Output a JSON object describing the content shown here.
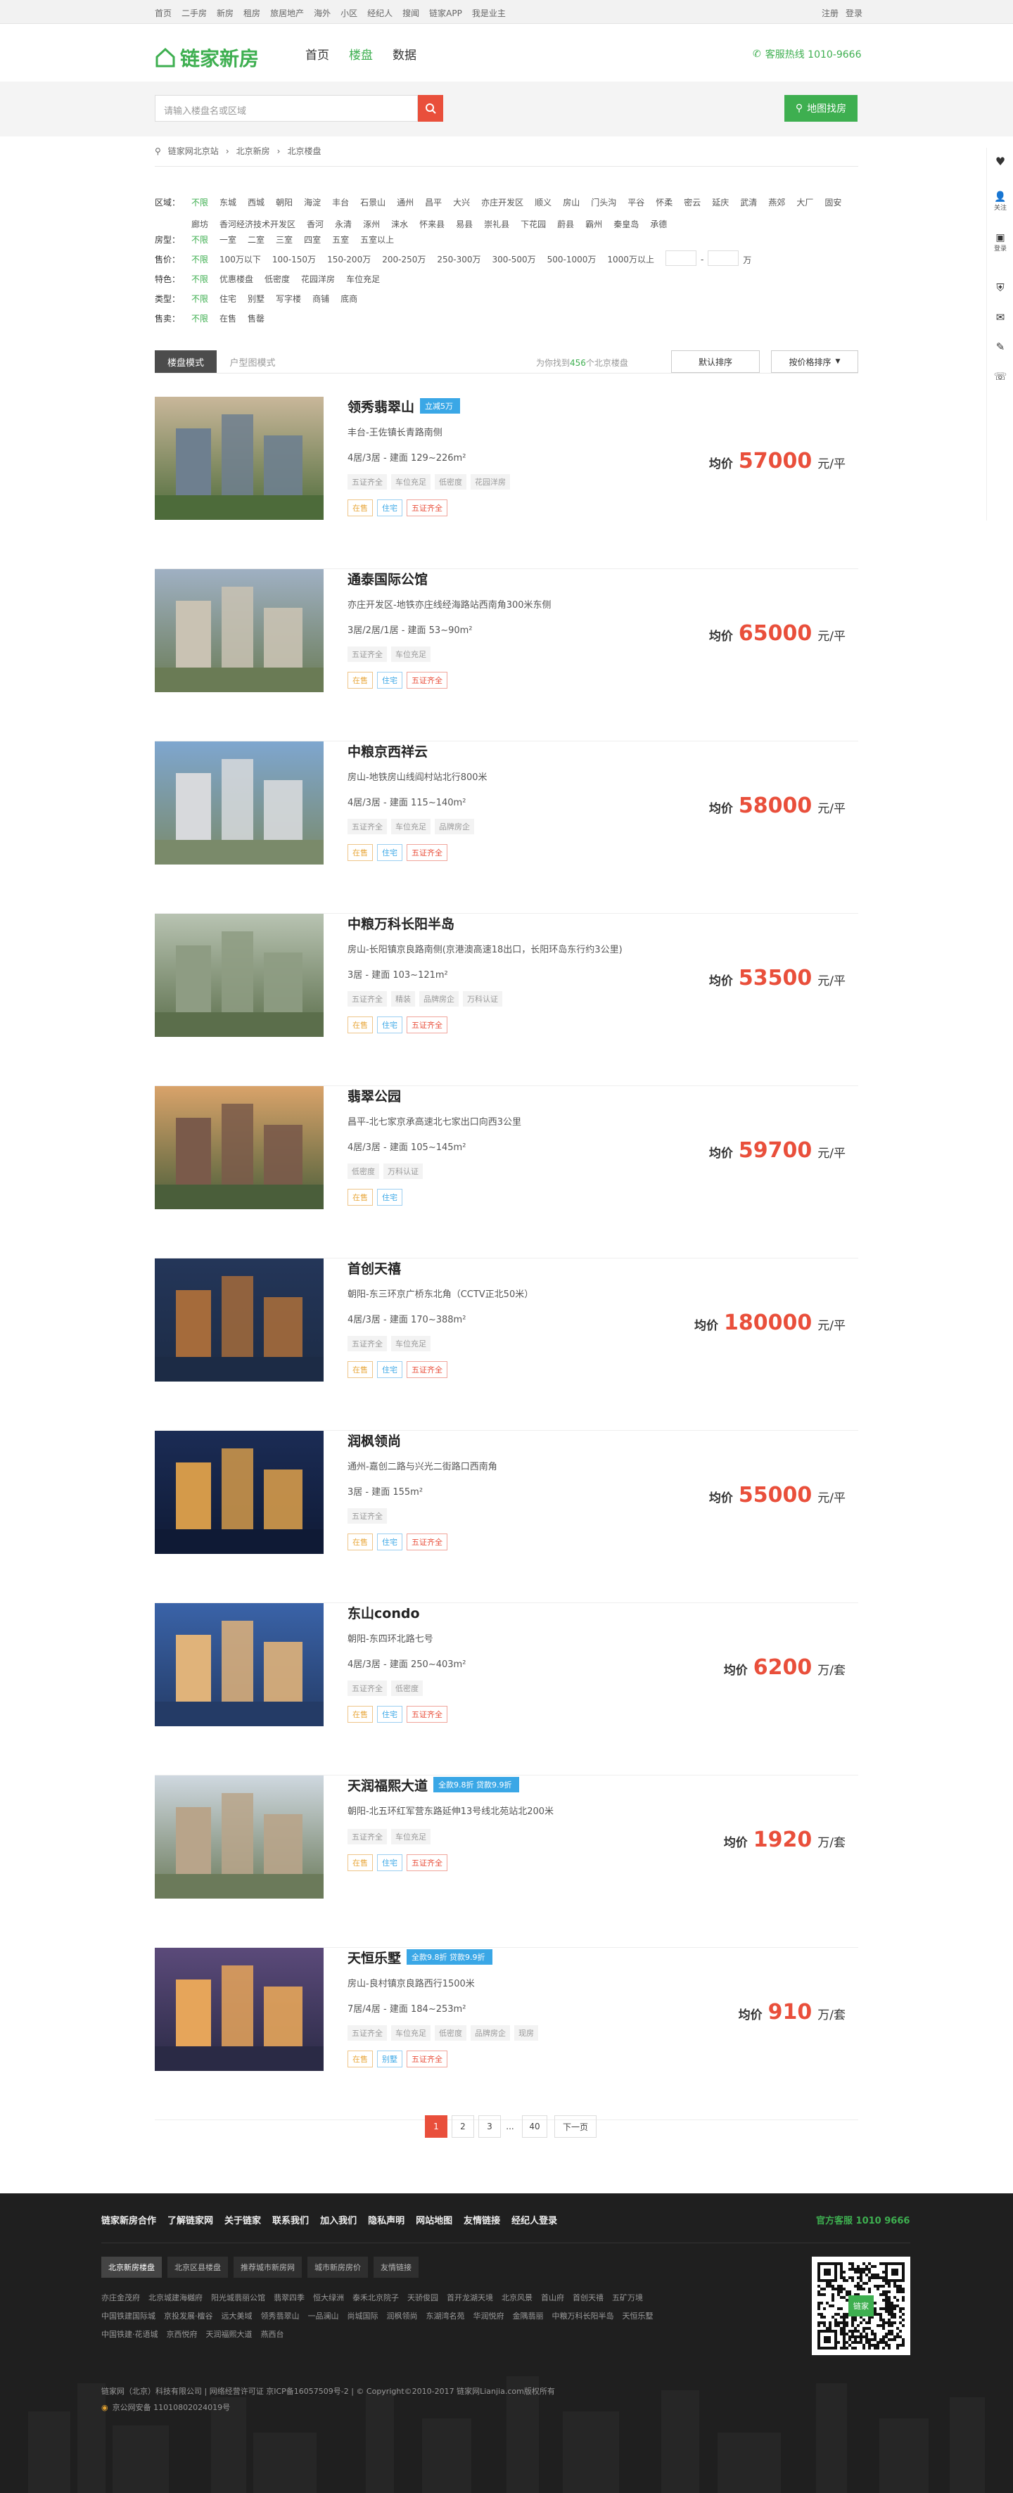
{
  "topbar": {
    "links": [
      "首页",
      "二手房",
      "新房",
      "租房",
      "旅居地产",
      "海外",
      "小区",
      "经纪人",
      "搜闻",
      "链家APP",
      "我是业主"
    ],
    "register": "注册",
    "login": "登录"
  },
  "header": {
    "logo_text": "链家新房",
    "nav": [
      "首页",
      "楼盘",
      "数据"
    ],
    "active_nav": "楼盘",
    "hotline": "客服热线 1010-9666"
  },
  "search": {
    "placeholder": "请输入楼盘名或区域",
    "map_button": "地图找房"
  },
  "right_toolbar": [
    "关注",
    "登录",
    "客服"
  ],
  "breadcrumb": [
    "链家网北京站",
    "北京新房",
    "北京楼盘"
  ],
  "filters": {
    "region": {
      "label": "区域：",
      "options": [
        "不限",
        "东城",
        "西城",
        "朝阳",
        "海淀",
        "丰台",
        "石景山",
        "通州",
        "昌平",
        "大兴",
        "亦庄开发区",
        "顺义",
        "房山",
        "门头沟",
        "平谷",
        "怀柔",
        "密云",
        "延庆",
        "武清",
        "燕郊",
        "大厂",
        "固安",
        "廊坊",
        "香河经济技术开发区",
        "香河",
        "永清",
        "涿州",
        "涞水",
        "怀来县",
        "易县",
        "崇礼县",
        "下花园",
        "蔚县",
        "霸州",
        "秦皇岛",
        "承德"
      ]
    },
    "room": {
      "label": "房型：",
      "options": [
        "不限",
        "一室",
        "二室",
        "三室",
        "四室",
        "五室",
        "五室以上"
      ]
    },
    "price": {
      "label": "售价：",
      "options": [
        "不限",
        "100万以下",
        "100-150万",
        "150-200万",
        "200-250万",
        "250-300万",
        "300-500万",
        "500-1000万",
        "1000万以上"
      ],
      "unit": "万"
    },
    "feature": {
      "label": "特色：",
      "options": [
        "不限",
        "优惠楼盘",
        "低密度",
        "花园洋房",
        "车位充足"
      ]
    },
    "type": {
      "label": "类型：",
      "options": [
        "不限",
        "住宅",
        "别墅",
        "写字楼",
        "商铺",
        "底商"
      ]
    },
    "status": {
      "label": "售卖：",
      "options": [
        "不限",
        "在售",
        "售罄"
      ]
    }
  },
  "list_header": {
    "tab_active": "楼盘模式",
    "tab_inactive": "户型图模式",
    "count_prefix": "为你找到",
    "count": "456",
    "count_suffix": "个北京楼盘",
    "sort_default": "默认排序",
    "sort_price": "按价格排序"
  },
  "listings": [
    {
      "name": "领秀翡翠山",
      "badge": "立减5万",
      "location": "丰台-王佐镇长青路南侧",
      "spec": "4居/3居 - 建面 129~226m²",
      "tags": [
        "五证齐全",
        "车位充足",
        "低密度",
        "花园洋房"
      ],
      "status": [
        "在售",
        "住宅",
        "五证齐全"
      ],
      "price_label": "均价",
      "price": "57000",
      "unit": "元/平"
    },
    {
      "name": "通泰国际公馆",
      "badge": "",
      "location": "亦庄开发区-地铁亦庄线经海路站西南角300米东侧",
      "spec": "3居/2居/1居 - 建面 53~90m²",
      "tags": [
        "五证齐全",
        "车位充足"
      ],
      "status": [
        "在售",
        "住宅",
        "五证齐全"
      ],
      "price_label": "均价",
      "price": "65000",
      "unit": "元/平"
    },
    {
      "name": "中粮京西祥云",
      "badge": "",
      "location": "房山-地铁房山线阎村站北行800米",
      "spec": "4居/3居 - 建面 115~140m²",
      "tags": [
        "五证齐全",
        "车位充足",
        "品牌房企"
      ],
      "status": [
        "在售",
        "住宅",
        "五证齐全"
      ],
      "price_label": "均价",
      "price": "58000",
      "unit": "元/平"
    },
    {
      "name": "中粮万科长阳半岛",
      "badge": "",
      "location": "房山-长阳镇京良路南侧(京港澳高速18出口，长阳环岛东行约3公里)",
      "spec": "3居 - 建面 103~121m²",
      "tags": [
        "五证齐全",
        "精装",
        "品牌房企",
        "万科认证"
      ],
      "status": [
        "在售",
        "住宅",
        "五证齐全"
      ],
      "price_label": "均价",
      "price": "53500",
      "unit": "元/平"
    },
    {
      "name": "翡翠公园",
      "badge": "",
      "location": "昌平-北七家京承高速北七家出口向西3公里",
      "spec": "4居/3居 - 建面 105~145m²",
      "tags": [
        "低密度",
        "万科认证"
      ],
      "status": [
        "在售",
        "住宅"
      ],
      "price_label": "均价",
      "price": "59700",
      "unit": "元/平"
    },
    {
      "name": "首创天禧",
      "badge": "",
      "location": "朝阳-东三环京广桥东北角（CCTV正北50米）",
      "spec": "4居/3居 - 建面 170~388m²",
      "tags": [
        "五证齐全",
        "车位充足"
      ],
      "status": [
        "在售",
        "住宅",
        "五证齐全"
      ],
      "price_label": "均价",
      "price": "180000",
      "unit": "元/平"
    },
    {
      "name": "润枫领尚",
      "badge": "",
      "location": "通州-嘉创二路与兴光二街路口西南角",
      "spec": "3居 - 建面 155m²",
      "tags": [
        "五证齐全"
      ],
      "status": [
        "在售",
        "住宅",
        "五证齐全"
      ],
      "price_label": "均价",
      "price": "55000",
      "unit": "元/平"
    },
    {
      "name": "东山condo",
      "badge": "",
      "location": "朝阳-东四环北路七号",
      "spec": "4居/3居 - 建面 250~403m²",
      "tags": [
        "五证齐全",
        "低密度"
      ],
      "status": [
        "在售",
        "住宅",
        "五证齐全"
      ],
      "price_label": "均价",
      "price": "6200",
      "unit": "万/套"
    },
    {
      "name": "天润福熙大道",
      "badge": "全款9.8折 贷款9.9折",
      "location": "朝阳-北五环红军营东路延伸13号线北苑站北200米",
      "spec": "",
      "tags": [
        "五证齐全",
        "车位充足"
      ],
      "status": [
        "在售",
        "住宅",
        "五证齐全"
      ],
      "price_label": "均价",
      "price": "1920",
      "unit": "万/套"
    },
    {
      "name": "天恒乐墅",
      "badge": "全款9.8折 贷款9.9折",
      "location": "房山-良村镇京良路西行1500米",
      "spec": "7居/4居 - 建面 184~253m²",
      "tags": [
        "五证齐全",
        "车位充足",
        "低密度",
        "品牌房企",
        "现房"
      ],
      "status": [
        "在售",
        "别墅",
        "五证齐全"
      ],
      "price_label": "均价",
      "price": "910",
      "unit": "万/套"
    }
  ],
  "pagination": {
    "pages": [
      "1",
      "2",
      "3"
    ],
    "ellipsis": "...",
    "last": "40",
    "next": "下一页"
  },
  "footer": {
    "links": [
      "链家新房合作",
      "了解链家网",
      "关于链家",
      "联系我们",
      "加入我们",
      "隐私声明",
      "网站地图",
      "友情链接",
      "经纪人登录"
    ],
    "hotline": "官方客服 1010 9666",
    "tabs": [
      "北京新房楼盘",
      "北京区县楼盘",
      "推荐城市新房网",
      "城市新房房价",
      "友情链接"
    ],
    "city_row1": [
      "亦庄金茂府",
      "北京城建海樾府",
      "阳光城翡丽公馆",
      "翡翠四季",
      "恒大绿洲",
      "泰禾北京院子",
      "天骄俊园",
      "首开龙湖天境",
      "北京风景",
      "首山府",
      "首创天禧",
      "五矿万境"
    ],
    "city_row2": [
      "中国铁建国际城",
      "京投发展·檀谷",
      "远大美域",
      "领秀翡翠山",
      "一品澜山",
      "尚城国际",
      "润枫领尚",
      "东湖湾名苑",
      "华润悦府",
      "金隅翡丽",
      "中粮万科长阳半岛",
      "天恒乐墅"
    ],
    "city_row3": [
      "中国铁建·花语城",
      "京西悦府",
      "天润福熙大道",
      "燕西台"
    ],
    "qr_label": "链家",
    "copyright": "链家网（北京）科技有限公司 | 网络经营许可证 京ICP备16057509号-2 | © Copyright©2010-2017 链家网Lianjia.com版权所有",
    "beian": "京公网安备 11010802024019号"
  }
}
